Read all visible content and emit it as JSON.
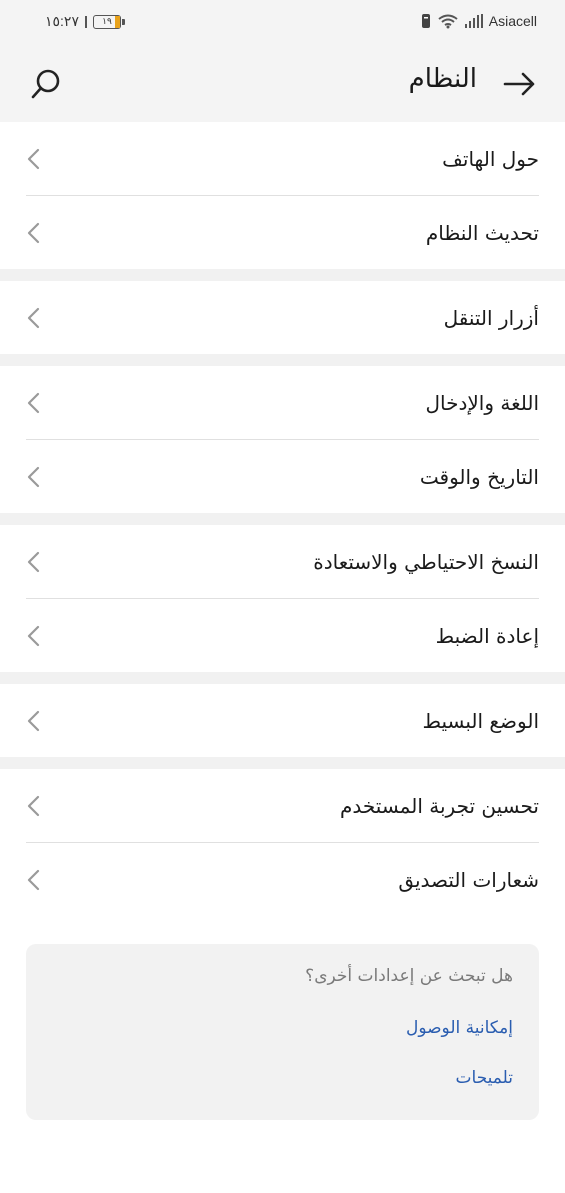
{
  "status_bar": {
    "time": "١٥:٢٧",
    "battery_level": "١٩",
    "carrier": "Asiacell"
  },
  "header": {
    "title": "النظام"
  },
  "groups": [
    [
      {
        "label": "حول الهاتف"
      },
      {
        "label": "تحديث النظام"
      }
    ],
    [
      {
        "label": "أزرار التنقل"
      }
    ],
    [
      {
        "label": "اللغة والإدخال"
      },
      {
        "label": "التاريخ والوقت"
      }
    ],
    [
      {
        "label": "النسخ الاحتياطي والاستعادة"
      },
      {
        "label": "إعادة الضبط"
      }
    ],
    [
      {
        "label": "الوضع البسيط"
      }
    ],
    [
      {
        "label": "تحسين تجربة المستخدم"
      },
      {
        "label": "شعارات التصديق"
      }
    ]
  ],
  "suggestions": {
    "question": "هل تبحث عن إعدادات أخرى؟",
    "links": [
      "إمكانية الوصول",
      "تلميحات"
    ]
  },
  "colors": {
    "accent_link": "#2a5db0",
    "battery_fill": "#e8a21b"
  }
}
